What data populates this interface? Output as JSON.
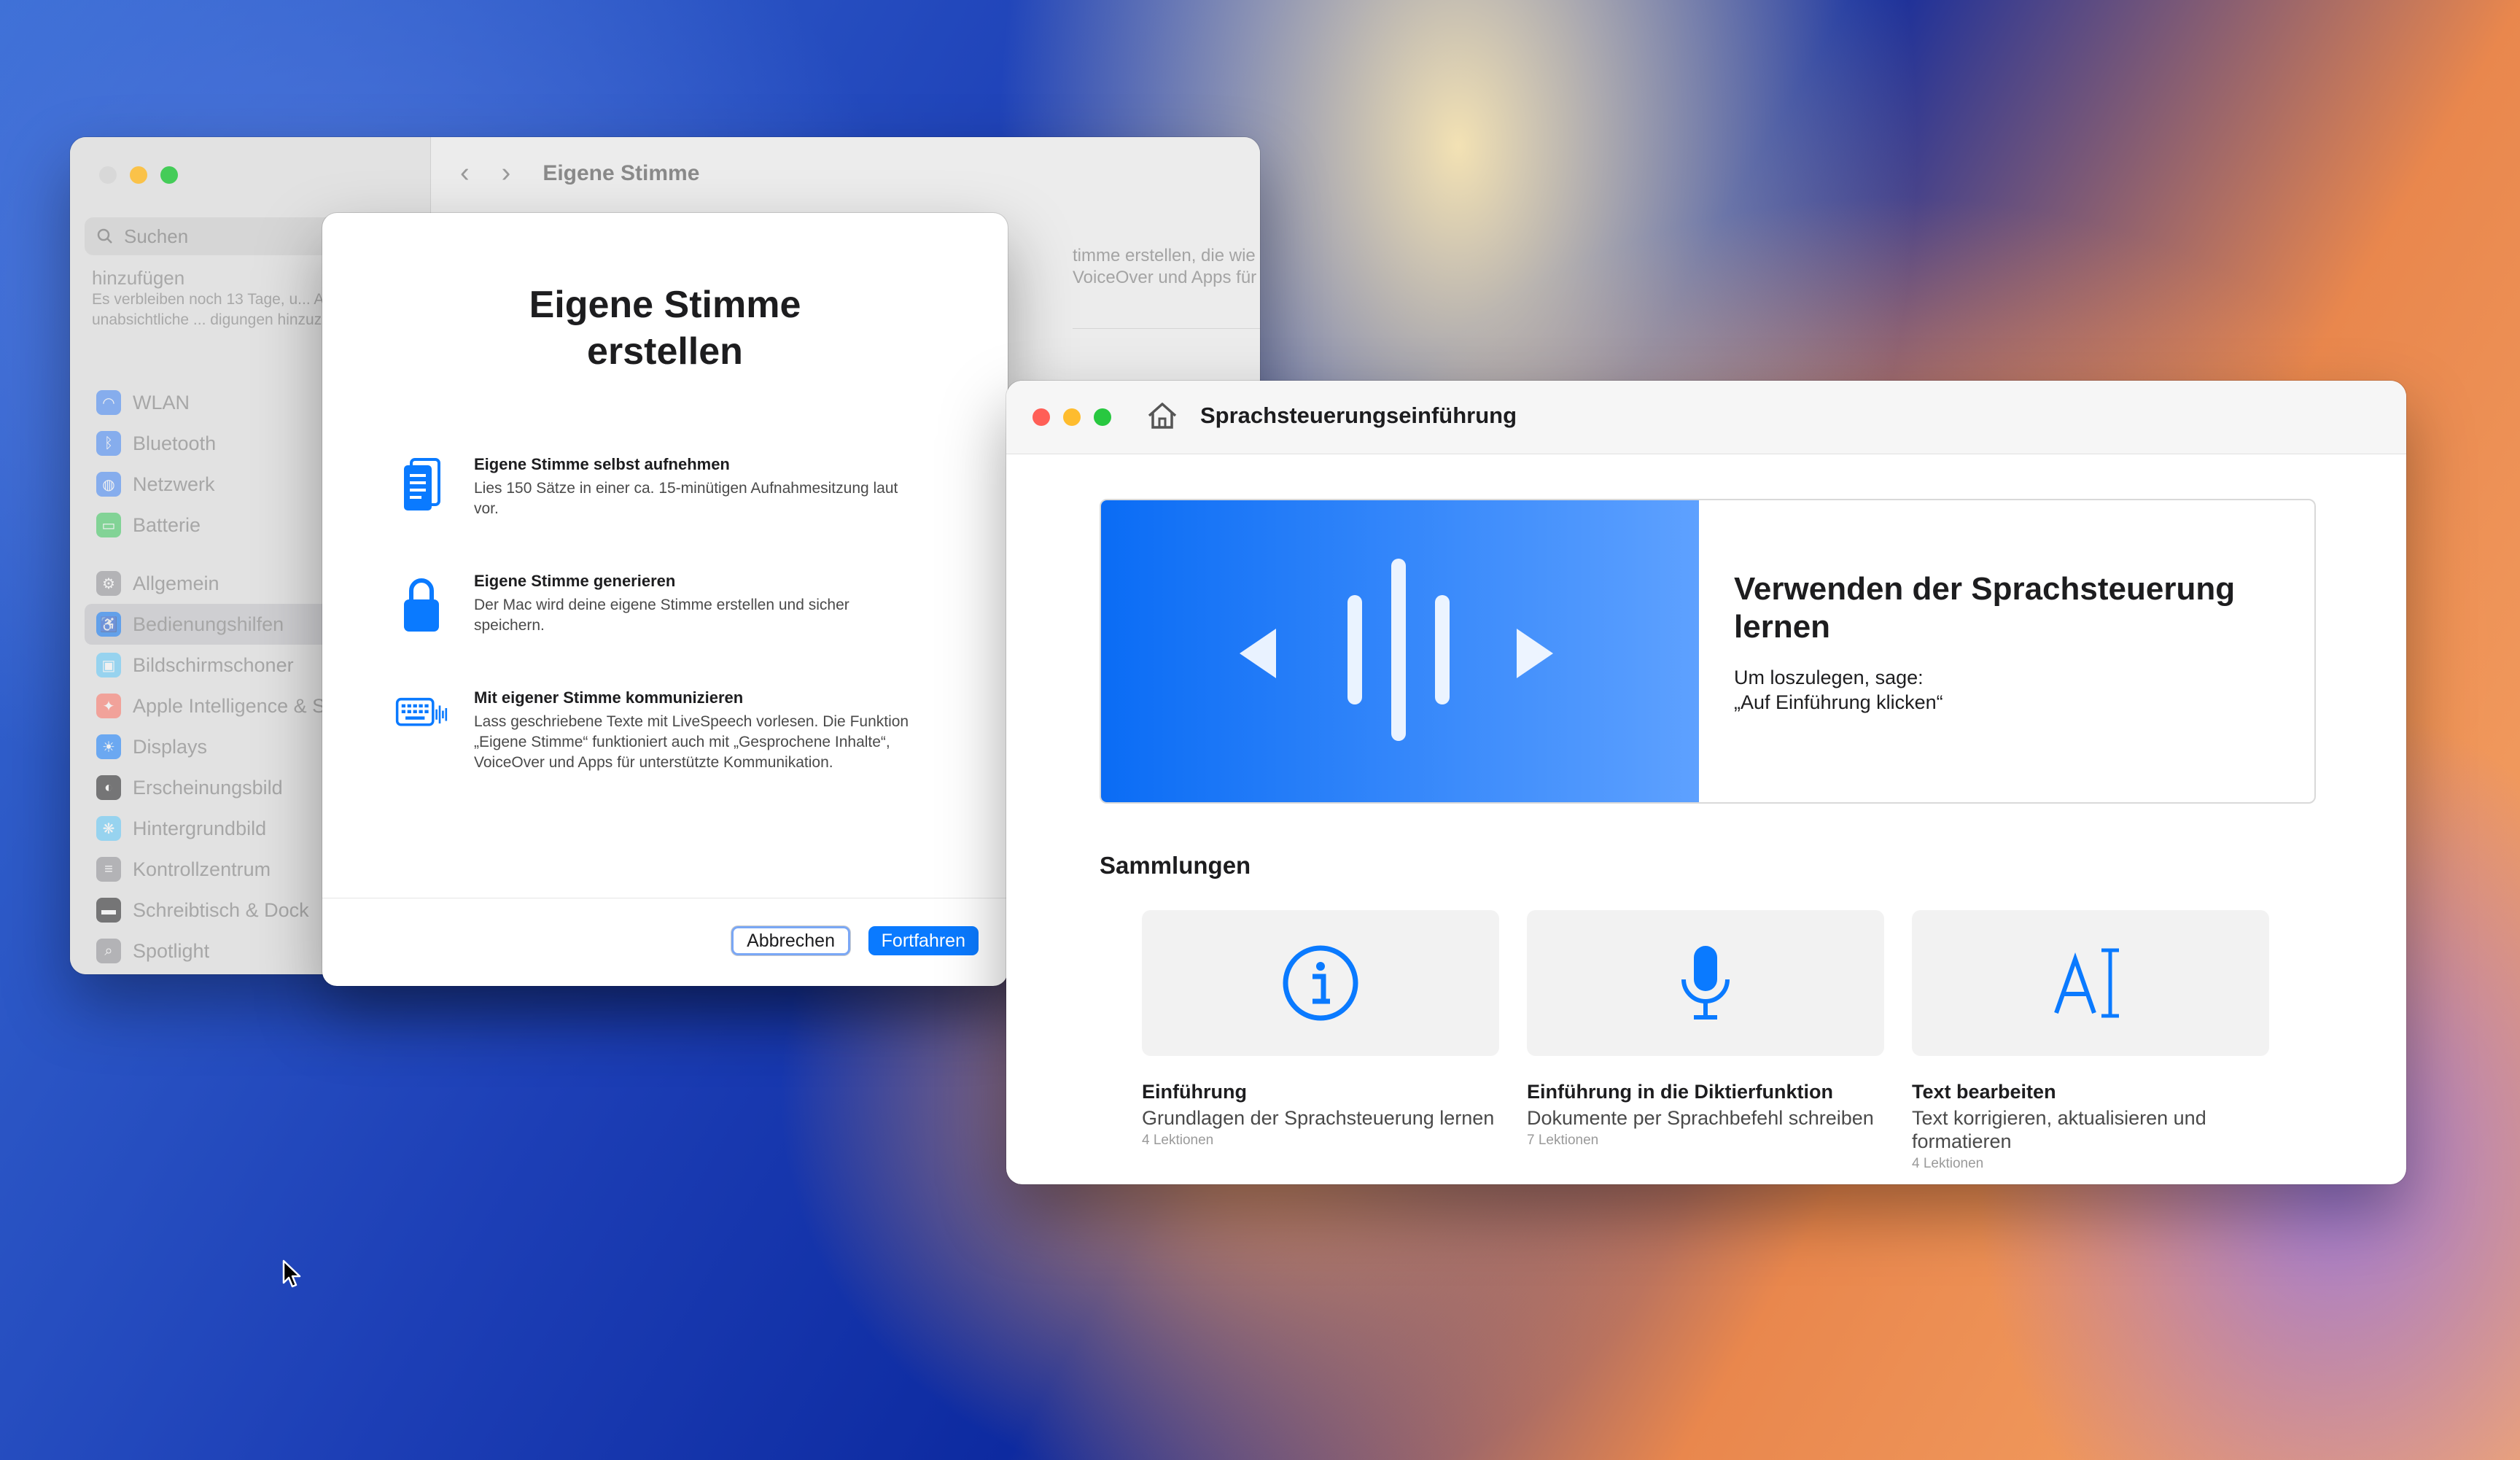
{
  "settings_window": {
    "title": "Eigene Stimme",
    "search_placeholder": "Suchen",
    "notice_title": "hinzufügen",
    "notice_text": "Es verbleiben noch 13 Tage, u... Abdeckung für unabsichtliche ... digungen hinzuzufügen.",
    "main_text": "timme erstellen, die wie VoiceOver und Apps für",
    "sidebar_items": [
      {
        "label": "WLAN",
        "icon": "wifi-icon",
        "color": "#3b82f6"
      },
      {
        "label": "Bluetooth",
        "icon": "bluetooth-icon",
        "color": "#3b82f6"
      },
      {
        "label": "Netzwerk",
        "icon": "globe-icon",
        "color": "#3b82f6"
      },
      {
        "label": "Batterie",
        "icon": "battery-icon",
        "color": "#34c759"
      },
      {
        "label": "Allgemein",
        "icon": "gear-icon",
        "color": "#8e8e93"
      },
      {
        "label": "Bedienungshilfen",
        "icon": "accessibility-icon",
        "color": "#0a7aff"
      },
      {
        "label": "Bildschirmschoner",
        "icon": "screensaver-icon",
        "color": "#5ac8fa"
      },
      {
        "label": "Apple Intelligence & S",
        "icon": "siri-icon",
        "color": "#ff6f61"
      },
      {
        "label": "Displays",
        "icon": "sun-icon",
        "color": "#0a7aff"
      },
      {
        "label": "Erscheinungsbild",
        "icon": "appearance-icon",
        "color": "#1d1d1f"
      },
      {
        "label": "Hintergrundbild",
        "icon": "wallpaper-icon",
        "color": "#5ac8fa"
      },
      {
        "label": "Kontrollzentrum",
        "icon": "control-center-icon",
        "color": "#8e8e93"
      },
      {
        "label": "Schreibtisch & Dock",
        "icon": "dock-icon",
        "color": "#1d1d1f"
      },
      {
        "label": "Spotlight",
        "icon": "spotlight-icon",
        "color": "#8e8e93"
      }
    ]
  },
  "dialog": {
    "title": "Eigene Stimme erstellen",
    "features": [
      {
        "title": "Eigene Stimme selbst aufnehmen",
        "desc": "Lies 150 Sätze in einer ca. 15-minütigen Aufnahmesitzung laut vor.",
        "icon": "document-icon"
      },
      {
        "title": "Eigene Stimme generieren",
        "desc": "Der Mac wird deine eigene Stimme erstellen und sicher speichern.",
        "icon": "lock-icon"
      },
      {
        "title": "Mit eigener Stimme kommunizieren",
        "desc": "Lass geschriebene Texte mit LiveSpeech vorlesen. Die Funktion „Eigene Stimme“ funktioniert auch mit „Gesprochene Inhalte“, VoiceOver und Apps für unterstützte Kommunikation.",
        "icon": "keyboard-waveform-icon"
      }
    ],
    "cancel_label": "Abbrechen",
    "continue_label": "Fortfahren"
  },
  "tutorial": {
    "title": "Sprachsteuerungseinführung",
    "hero_title": "Verwenden der Sprachsteuerung lernen",
    "hero_line1": "Um loszulegen, sage:",
    "hero_line2": "„Auf Einführung klicken“",
    "section_title": "Sammlungen",
    "cards": [
      {
        "title": "Einführung",
        "desc": "Grundlagen der Sprachsteuerung lernen",
        "lessons": "4 Lektionen",
        "icon": "info-icon"
      },
      {
        "title": "Einführung in die Diktierfunktion",
        "desc": "Dokumente per Sprachbefehl schreiben",
        "lessons": "7 Lektionen",
        "icon": "microphone-icon"
      },
      {
        "title": "Text bearbeiten",
        "desc": "Text korrigieren, aktualisieren und formatieren",
        "lessons": "4 Lektionen",
        "icon": "text-cursor-icon"
      }
    ]
  },
  "colors": {
    "accent": "#0a7aff",
    "hero_gradient_start": "#0a6cf5",
    "hero_gradient_end": "#5ea1ff"
  }
}
